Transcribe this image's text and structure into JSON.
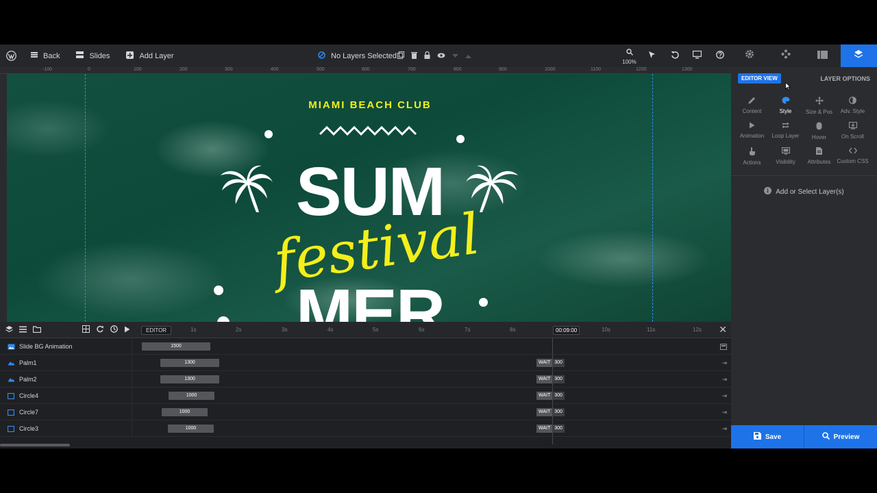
{
  "toolbar": {
    "back_label": "Back",
    "slides_label": "Slides",
    "add_layer_label": "Add Layer",
    "selection_status": "No Layers Selected",
    "zoom_level": "100%"
  },
  "ruler": {
    "ticks": [
      "-100",
      "0",
      "100",
      "200",
      "300",
      "400",
      "500",
      "600",
      "700",
      "800",
      "900",
      "1000",
      "1100",
      "1200",
      "1300"
    ]
  },
  "canvas": {
    "miami_text": "MIAMI BEACH CLUB",
    "sum_text": "SUM",
    "festival_text": "festival",
    "mer_text": "MER"
  },
  "panel": {
    "editor_view_label": "EDITOR VIEW",
    "layer_options_label": "LAYER OPTIONS",
    "options": [
      {
        "label": "Content",
        "icon": "pencil-icon"
      },
      {
        "label": "Style",
        "icon": "palette-icon"
      },
      {
        "label": "Size & Pos",
        "icon": "move-icon"
      },
      {
        "label": "Adv. Style",
        "icon": "contrast-icon"
      },
      {
        "label": "Animation",
        "icon": "play-icon"
      },
      {
        "label": "Loop Layer",
        "icon": "loop-icon"
      },
      {
        "label": "Hover",
        "icon": "mouse-icon"
      },
      {
        "label": "On Scroll",
        "icon": "scroll-icon"
      },
      {
        "label": "Actions",
        "icon": "hand-icon"
      },
      {
        "label": "Visibility",
        "icon": "visibility-icon"
      },
      {
        "label": "Attributes",
        "icon": "document-icon"
      },
      {
        "label": "Custom CSS",
        "icon": "code-icon"
      }
    ],
    "active_option": "Style",
    "add_select_label": "Add or Select Layer(s)",
    "save_label": "Save",
    "preview_label": "Preview"
  },
  "timeline": {
    "editor_label": "EDITOR",
    "ticks": [
      "1s",
      "2s",
      "3s",
      "4s",
      "5s",
      "6s",
      "7s",
      "8s",
      "10s",
      "11s",
      "12s"
    ],
    "current_time": "00:09:00",
    "rows": [
      {
        "name": "Slide BG Animation",
        "duration": "1500",
        "wait": "",
        "wait_value": ""
      },
      {
        "name": "Palm1",
        "duration": "1300",
        "wait": "WAIT",
        "wait_value": "300"
      },
      {
        "name": "Palm2",
        "duration": "1300",
        "wait": "WAIT",
        "wait_value": "300"
      },
      {
        "name": "Circle4",
        "duration": "1000",
        "wait": "WAIT",
        "wait_value": "300"
      },
      {
        "name": "Circle7",
        "duration": "1000",
        "wait": "WAIT",
        "wait_value": "300"
      },
      {
        "name": "Circle3",
        "duration": "1000",
        "wait": "WAIT",
        "wait_value": "300"
      }
    ]
  },
  "colors": {
    "accent": "#1e73e8",
    "headline_yellow": "#f3ef1a",
    "canvas_green": "#0d4a3a"
  }
}
